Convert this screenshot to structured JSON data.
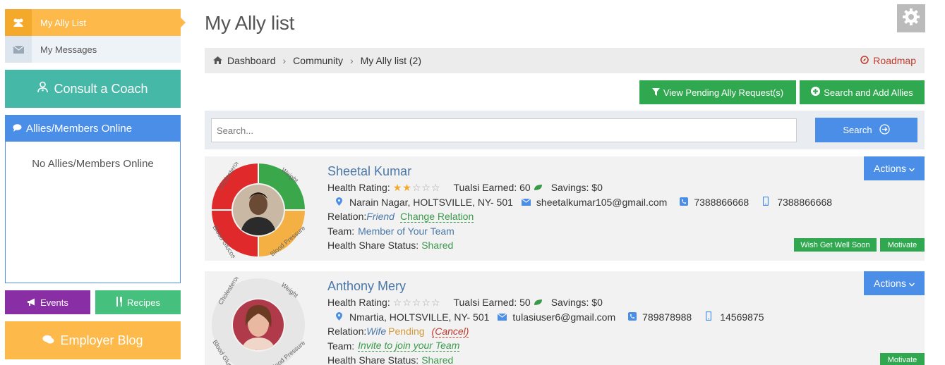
{
  "sidebar": {
    "ally_list": "My Ally List",
    "messages": "My Messages",
    "consult": "Consult a Coach",
    "online_title": "Allies/Members Online",
    "online_empty": "No Allies/Members Online",
    "events": "Events",
    "recipes": "Recipes",
    "blog": "Employer Blog"
  },
  "page": {
    "title": "My Ally list"
  },
  "breadcrumb": {
    "items": [
      "Dashboard",
      "Community",
      "My Ally list (2)"
    ],
    "roadmap": "Roadmap"
  },
  "toolbar": {
    "pending": "View Pending Ally Request(s)",
    "search_add": "Search and Add Allies"
  },
  "search": {
    "placeholder": "Search...",
    "button": "Search"
  },
  "ring_labels": {
    "cholesterol": "Cholesterol",
    "weight": "Weight",
    "glucose": "Blood Glucose",
    "pressure": "Blood Pressure"
  },
  "allies": [
    {
      "name": "Sheetal Kumar",
      "health_rating_label": "Health Rating:",
      "rating": 2,
      "tualsi_label": "Tualsi Earned: 60",
      "savings": "Savings: $0",
      "address": "Narain Nagar, HOLTSVILLE, NY- 501",
      "email": "sheetalkumar105@gmail.com",
      "phone": "7388866668",
      "mobile": "7388866668",
      "relation_label": "Relation:",
      "relation_value": "Friend",
      "relation_action": "Change Relation",
      "team_label": "Team:",
      "team_value": "Member of Your Team",
      "share_label": "Health Share Status:",
      "share_value": "Shared",
      "actions": "Actions",
      "buttons": [
        "Wish Get Well Soon",
        "Motivate"
      ],
      "ring_colors": {
        "weight": "#3aa84a",
        "pressure": "#f4b042",
        "glucose": "#e0292b",
        "cholesterol": "#e0292b"
      }
    },
    {
      "name": "Anthony Mery",
      "health_rating_label": "Health Rating:",
      "rating": 0,
      "tualsi_label": "Tualsi Earned: 50",
      "savings": "Savings: $0",
      "address": "Nmartia, HOLTSVILLE, NY- 501",
      "email": "tulasiuser6@gmail.com",
      "phone": "789878988",
      "mobile": "14569875",
      "relation_label": "Relation:",
      "relation_value": "Wife",
      "relation_status": "Pending",
      "relation_action": "(Cancel)",
      "team_label": "Team:",
      "team_value": "Invite to join your Team",
      "share_label": "Health Share Status:",
      "share_value": "Shared",
      "actions": "Actions",
      "buttons": [
        "Motivate"
      ],
      "ring_colors": {
        "weight": "#e6e6e6",
        "pressure": "#e6e6e6",
        "glucose": "#e6e6e6",
        "cholesterol": "#e6e6e6"
      }
    }
  ]
}
